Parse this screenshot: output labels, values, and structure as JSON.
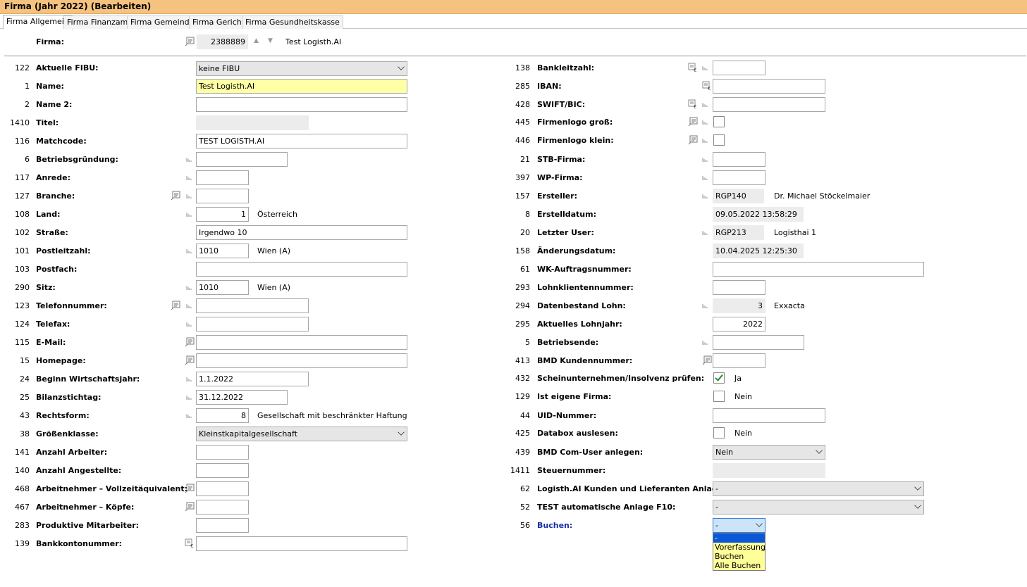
{
  "window": {
    "title": "Firma (Jahr 2022) (Bearbeiten)"
  },
  "tabs": [
    "Firma Allgemein",
    "Firma Finanzamt",
    "Firma Gemeinde",
    "Firma Gericht",
    "Firma Gesundheitskasse"
  ],
  "firma": {
    "label": "Firma:",
    "number": "2388889",
    "name": "Test Logisth.AI"
  },
  "left": [
    {
      "num": "122",
      "label": "Aktuelle FIBU:",
      "value": "keine FIBU"
    },
    {
      "num": "1",
      "label": "Name:",
      "value": "Test Logisth.AI"
    },
    {
      "num": "2",
      "label": "Name 2:",
      "value": ""
    },
    {
      "num": "1410",
      "label": "Titel:",
      "value": ""
    },
    {
      "num": "116",
      "label": "Matchcode:",
      "value": "TEST LOGISTH.AI"
    },
    {
      "num": "6",
      "label": "Betriebsgründung:",
      "value": ""
    },
    {
      "num": "117",
      "label": "Anrede:",
      "value": ""
    },
    {
      "num": "127",
      "label": "Branche:",
      "value": ""
    },
    {
      "num": "108",
      "label": "Land:",
      "value": "1",
      "desc": "Österreich"
    },
    {
      "num": "102",
      "label": "Straße:",
      "value": "Irgendwo 10"
    },
    {
      "num": "101",
      "label": "Postleitzahl:",
      "value": "1010",
      "desc": "Wien (A)"
    },
    {
      "num": "103",
      "label": "Postfach:",
      "value": ""
    },
    {
      "num": "290",
      "label": "Sitz:",
      "value": "1010",
      "desc": "Wien (A)"
    },
    {
      "num": "123",
      "label": "Telefonnummer:",
      "value": ""
    },
    {
      "num": "124",
      "label": "Telefax:",
      "value": ""
    },
    {
      "num": "115",
      "label": "E-Mail:",
      "value": ""
    },
    {
      "num": "15",
      "label": "Homepage:",
      "value": ""
    },
    {
      "num": "24",
      "label": "Beginn Wirtschaftsjahr:",
      "value": "1.1.2022"
    },
    {
      "num": "25",
      "label": "Bilanzstichtag:",
      "value": "31.12.2022"
    },
    {
      "num": "43",
      "label": "Rechtsform:",
      "value": "8",
      "desc": "Gesellschaft mit beschränkter Haftung"
    },
    {
      "num": "38",
      "label": "Größenklasse:",
      "value": "Kleinstkapitalgesellschaft"
    },
    {
      "num": "141",
      "label": "Anzahl Arbeiter:",
      "value": ""
    },
    {
      "num": "140",
      "label": "Anzahl Angestellte:",
      "value": ""
    },
    {
      "num": "468",
      "label": "Arbeitnehmer – Vollzeitäquivalent:",
      "value": ""
    },
    {
      "num": "467",
      "label": "Arbeitnehmer – Köpfe:",
      "value": ""
    },
    {
      "num": "283",
      "label": "Produktive Mitarbeiter:",
      "value": ""
    },
    {
      "num": "139",
      "label": "Bankkontonummer:",
      "value": ""
    }
  ],
  "right": [
    {
      "num": "138",
      "label": "Bankleitzahl:",
      "value": ""
    },
    {
      "num": "285",
      "label": "IBAN:",
      "value": ""
    },
    {
      "num": "428",
      "label": "SWIFT/BIC:",
      "value": ""
    },
    {
      "num": "445",
      "label": "Firmenlogo groß:",
      "value": ""
    },
    {
      "num": "446",
      "label": "Firmenlogo klein:",
      "value": ""
    },
    {
      "num": "21",
      "label": "STB-Firma:",
      "value": ""
    },
    {
      "num": "397",
      "label": "WP-Firma:",
      "value": ""
    },
    {
      "num": "157",
      "label": "Ersteller:",
      "value": "RGP140",
      "desc": "Dr. Michael Stöckelmaier"
    },
    {
      "num": "8",
      "label": "Erstelldatum:",
      "value": "09.05.2022 13:58:29"
    },
    {
      "num": "20",
      "label": "Letzter User:",
      "value": "RGP213",
      "desc": "Logisthai 1"
    },
    {
      "num": "158",
      "label": "Änderungsdatum:",
      "value": "10.04.2025 12:25:30"
    },
    {
      "num": "61",
      "label": "WK-Auftragsnummer:",
      "value": ""
    },
    {
      "num": "293",
      "label": "Lohnklientennummer:",
      "value": ""
    },
    {
      "num": "294",
      "label": "Datenbestand Lohn:",
      "value": "3",
      "desc": "Exxacta"
    },
    {
      "num": "295",
      "label": "Aktuelles Lohnjahr:",
      "value": "2022"
    },
    {
      "num": "5",
      "label": "Betriebsende:",
      "value": ""
    },
    {
      "num": "413",
      "label": "BMD Kundennummer:",
      "value": ""
    },
    {
      "num": "432",
      "label": "Scheinunternehmen/Insolvenz prüfen:",
      "value": "",
      "desc": "Ja"
    },
    {
      "num": "129",
      "label": "Ist eigene Firma:",
      "value": "",
      "desc": "Nein"
    },
    {
      "num": "44",
      "label": "UID-Nummer:",
      "value": ""
    },
    {
      "num": "425",
      "label": "Databox auslesen:",
      "value": "",
      "desc": "Nein"
    },
    {
      "num": "439",
      "label": "BMD Com-User anlegen:",
      "value": "Nein"
    },
    {
      "num": "1411",
      "label": "Steuernummer:",
      "value": ""
    },
    {
      "num": "62",
      "label": "Logisth.AI Kunden und Lieferanten Anlage:",
      "value": "-"
    },
    {
      "num": "52",
      "label": "TEST automatische Anlage F10:",
      "value": "-"
    },
    {
      "num": "56",
      "label": "Buchen:",
      "value": "-"
    }
  ],
  "buchen_dropdown": {
    "options": [
      "-",
      "Vorerfassung",
      "Buchen",
      "Alle Buchen"
    ],
    "selected": "-"
  },
  "colors": {
    "titlebar": "#f5c27f",
    "highlight_field": "#ffffa6",
    "dropdown_bg": "#ffff99",
    "dropdown_selected": "#0a58d6",
    "label_blue": "#1a2ea8"
  }
}
